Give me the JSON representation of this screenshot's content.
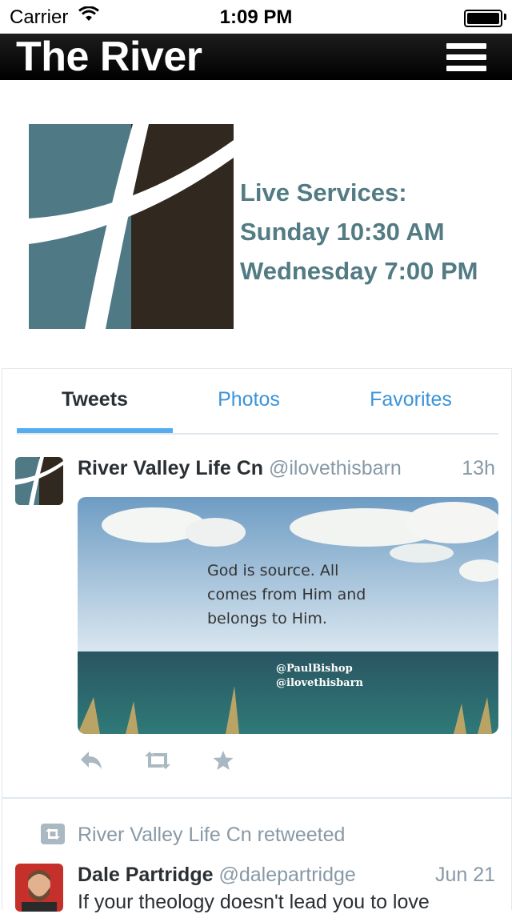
{
  "status_bar": {
    "carrier": "Carrier",
    "time": "1:09 PM"
  },
  "nav": {
    "title": "The River",
    "menu_icon": "hamburger-menu-icon"
  },
  "header": {
    "logo_icon": "river-cross-logo",
    "services_lines": [
      "Live Services:",
      "Sunday 10:30 AM",
      "Wednesday 7:00 PM"
    ]
  },
  "timeline": {
    "tabs": [
      {
        "label": "Tweets",
        "active": true
      },
      {
        "label": "Photos",
        "active": false
      },
      {
        "label": "Favorites",
        "active": false
      }
    ],
    "tweets": [
      {
        "name": "River Valley Life Cn",
        "handle": "@ilovethisbarn",
        "time": "13h",
        "media": {
          "quote_lines": [
            "God is source. All",
            "comes from Him and",
            "belongs to Him."
          ],
          "credit_lines": [
            "@PaulBishop",
            "@ilovethisbarn"
          ]
        },
        "actions": [
          "reply-icon",
          "retweet-icon",
          "favorite-icon"
        ]
      },
      {
        "retweeted_by": "River Valley Life Cn retweeted",
        "name": "Dale Partridge",
        "handle": "@dalepartridge",
        "time": "Jun 21",
        "text": "If your theology doesn't lead you to love"
      }
    ]
  },
  "colors": {
    "accent": "#55acee",
    "services_text": "#527b83",
    "logo_teal": "#4f7a85",
    "logo_brown": "#31281f"
  }
}
